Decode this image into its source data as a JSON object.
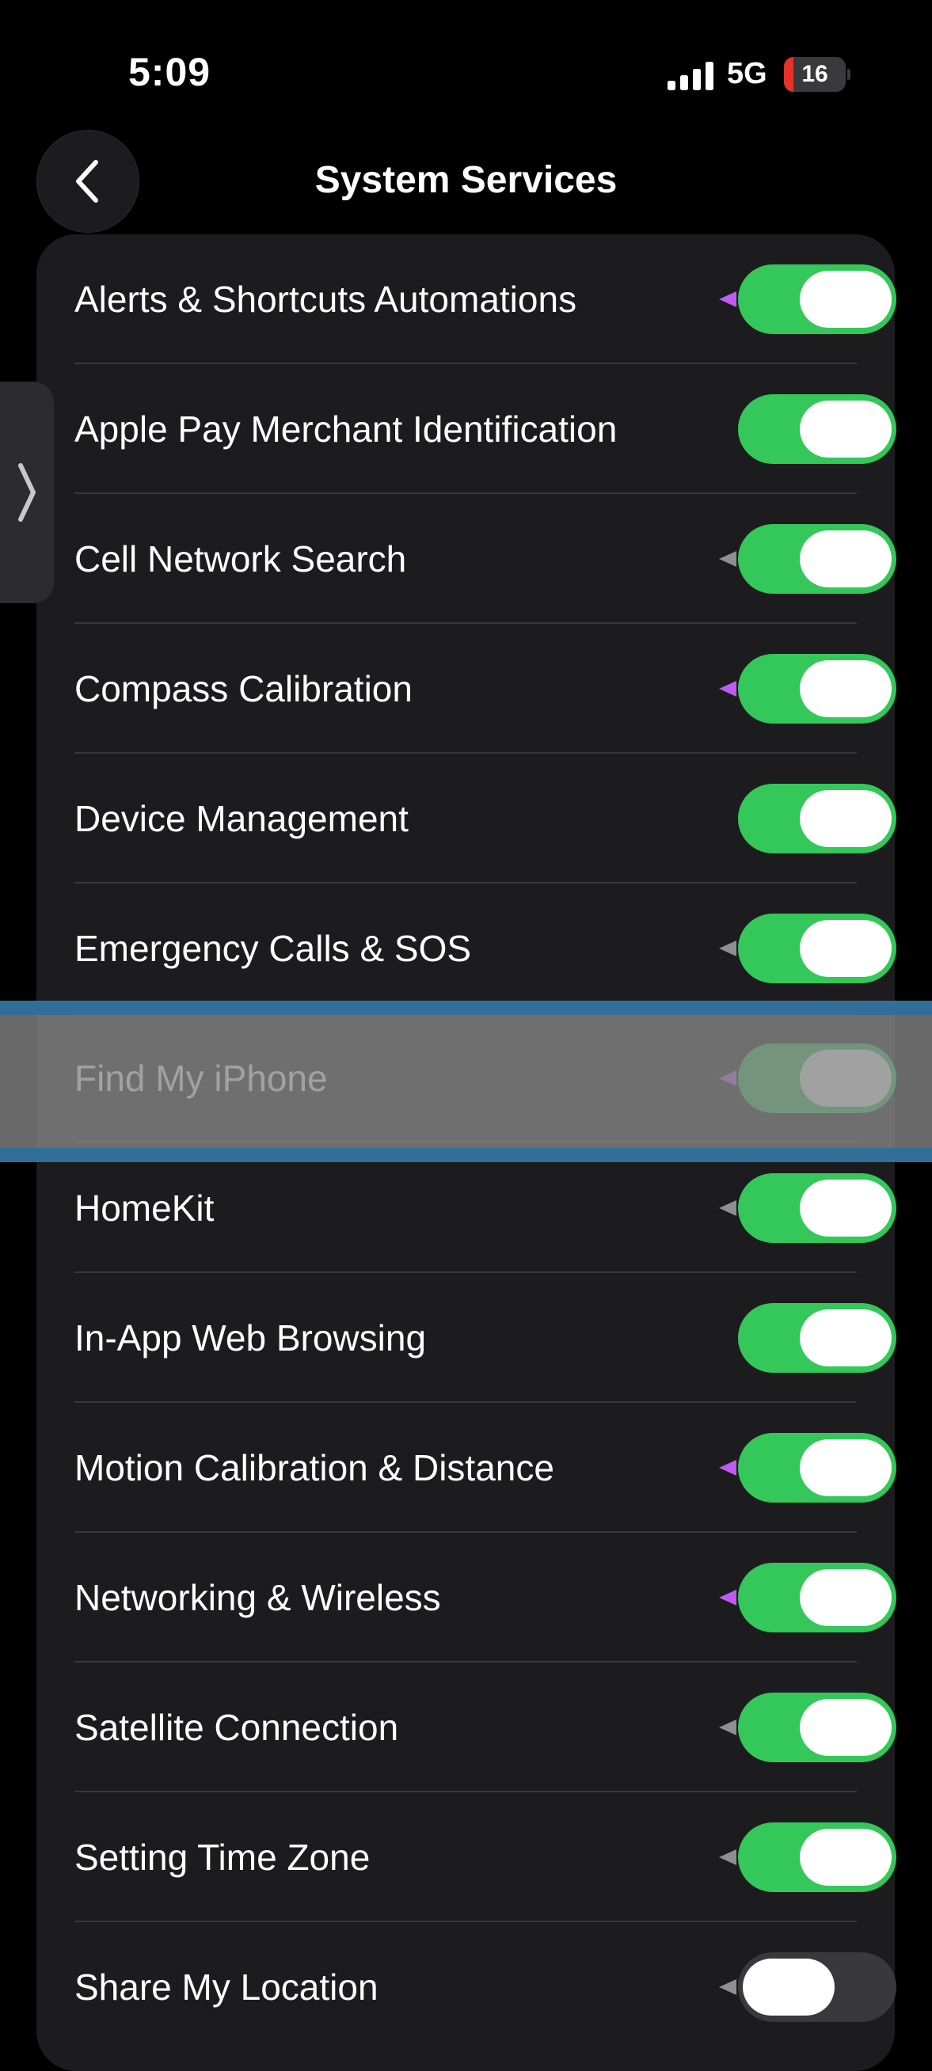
{
  "status_bar": {
    "time": "5:09",
    "network": "5G",
    "battery_level": "16",
    "battery_fraction": 0.16,
    "signal_icon": "signal-bars-icon"
  },
  "nav": {
    "title": "System Services",
    "back_icon": "chevron-left-icon"
  },
  "side_handle_icon": "chevron-right-icon",
  "colors": {
    "toggle_on": "#34c759",
    "toggle_off": "#39393d",
    "location_used": "#bf5af2",
    "location_gray": "#8e8e93"
  },
  "services": [
    {
      "label": "Alerts & Shortcuts Automations",
      "enabled": true,
      "location_indicator": "purple"
    },
    {
      "label": "Apple Pay Merchant Identification",
      "enabled": true,
      "location_indicator": "none"
    },
    {
      "label": "Cell Network Search",
      "enabled": true,
      "location_indicator": "gray"
    },
    {
      "label": "Compass Calibration",
      "enabled": true,
      "location_indicator": "purple"
    },
    {
      "label": "Device Management",
      "enabled": true,
      "location_indicator": "none"
    },
    {
      "label": "Emergency Calls & SOS",
      "enabled": true,
      "location_indicator": "gray"
    },
    {
      "label": "Find My iPhone",
      "enabled": true,
      "location_indicator": "purple"
    },
    {
      "label": "HomeKit",
      "enabled": true,
      "location_indicator": "gray"
    },
    {
      "label": "In-App Web Browsing",
      "enabled": true,
      "location_indicator": "none"
    },
    {
      "label": "Motion Calibration & Distance",
      "enabled": true,
      "location_indicator": "purple"
    },
    {
      "label": "Networking & Wireless",
      "enabled": true,
      "location_indicator": "purple"
    },
    {
      "label": "Satellite Connection",
      "enabled": true,
      "location_indicator": "gray"
    },
    {
      "label": "Setting Time Zone",
      "enabled": true,
      "location_indicator": "gray"
    },
    {
      "label": "Share My Location",
      "enabled": false,
      "location_indicator": "gray"
    }
  ],
  "highlighted_row": "Find My iPhone"
}
